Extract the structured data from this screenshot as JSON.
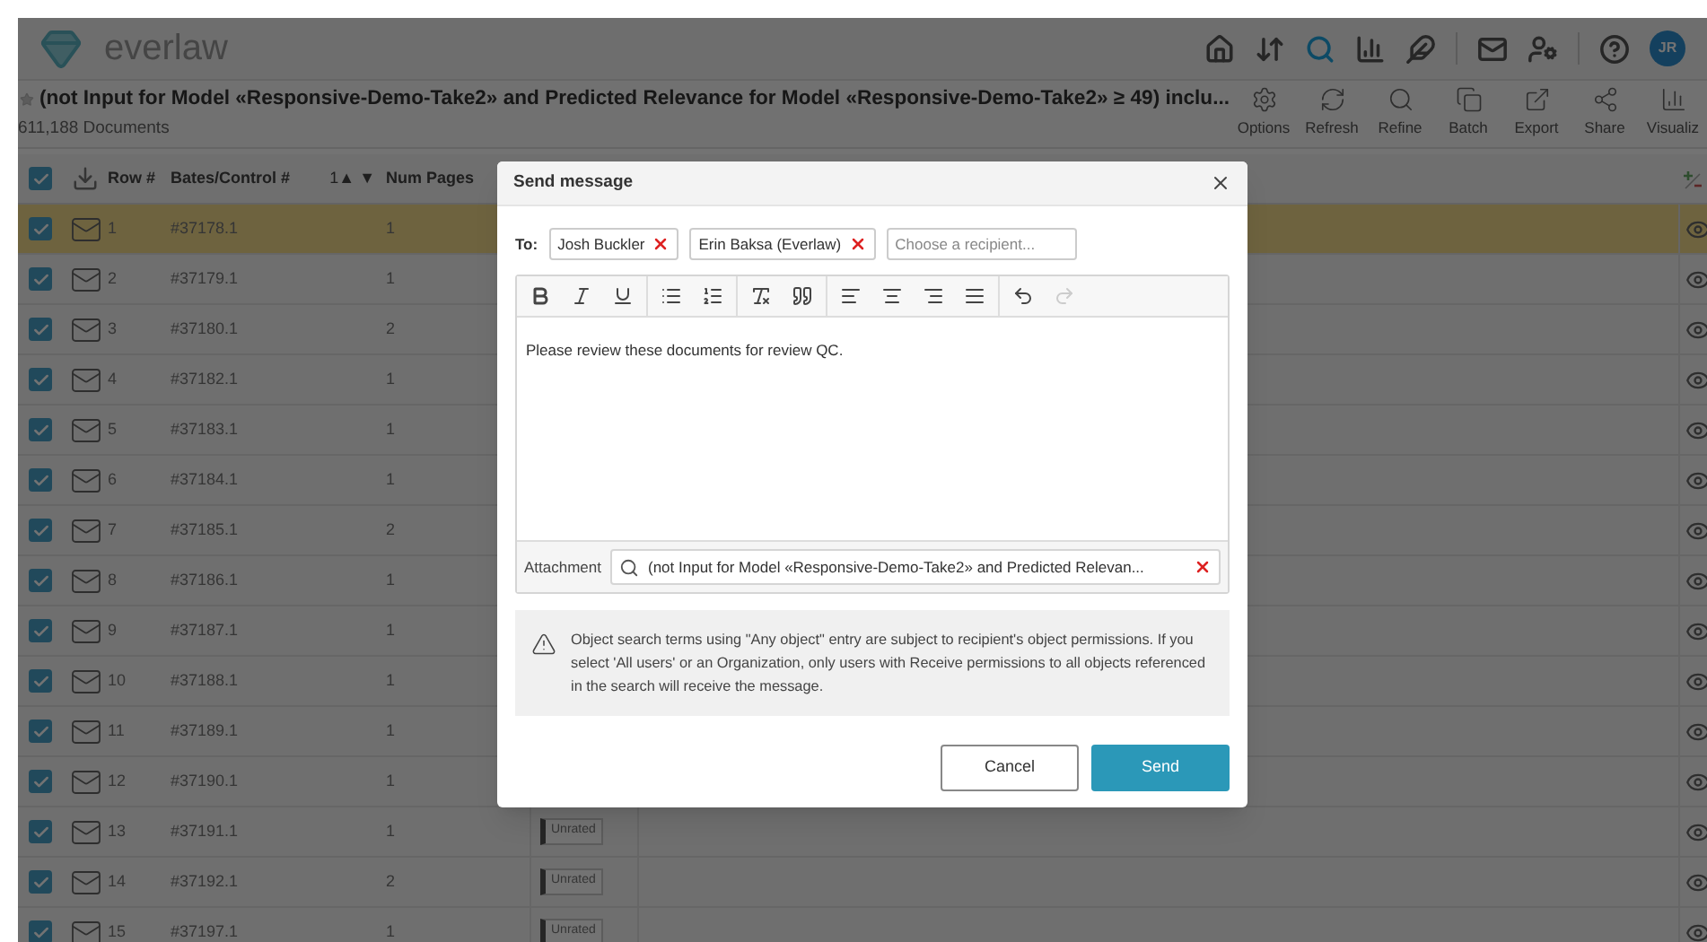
{
  "header": {
    "logo": "everlaw",
    "avatar": "JR",
    "nav": [
      {
        "kind": "home",
        "selected": false
      },
      {
        "kind": "sort",
        "selected": false
      },
      {
        "kind": "search",
        "selected": true
      },
      {
        "kind": "chart",
        "selected": false
      },
      {
        "kind": "feather",
        "selected": false
      },
      {
        "kind": "mail",
        "selected": false
      },
      {
        "kind": "admin",
        "selected": false
      },
      {
        "kind": "help",
        "selected": false
      }
    ]
  },
  "search": {
    "title": "(not Input for Model «Responsive-Demo-Take2» and Predicted Relevance for Model «Responsive-Demo-Take2» ≥ 49) inclu...",
    "count": "611,188 Documents",
    "actions": [
      {
        "kind": "options",
        "label": "Options"
      },
      {
        "kind": "refresh",
        "label": "Refresh"
      },
      {
        "kind": "refine",
        "label": "Refine"
      },
      {
        "kind": "batch",
        "label": "Batch"
      },
      {
        "kind": "export",
        "label": "Export"
      },
      {
        "kind": "share",
        "label": "Share"
      },
      {
        "kind": "visualize",
        "label": "Visualiz"
      }
    ]
  },
  "table": {
    "all_checked": true,
    "columns": [
      {
        "label": "Row #"
      },
      {
        "label": "Bates/Control #",
        "sort": "1▲ ▼"
      },
      {
        "label": "Num Pages"
      }
    ],
    "rows": [
      {
        "checked": true,
        "selected": true,
        "row": "1",
        "bates": "#37178.1",
        "pages": "1"
      },
      {
        "checked": true,
        "selected": false,
        "row": "2",
        "bates": "#37179.1",
        "pages": "1"
      },
      {
        "checked": true,
        "selected": false,
        "row": "3",
        "bates": "#37180.1",
        "pages": "2"
      },
      {
        "checked": true,
        "selected": false,
        "row": "4",
        "bates": "#37182.1",
        "pages": "1"
      },
      {
        "checked": true,
        "selected": false,
        "row": "5",
        "bates": "#37183.1",
        "pages": "1"
      },
      {
        "checked": true,
        "selected": false,
        "row": "6",
        "bates": "#37184.1",
        "pages": "1"
      },
      {
        "checked": true,
        "selected": false,
        "row": "7",
        "bates": "#37185.1",
        "pages": "2"
      },
      {
        "checked": true,
        "selected": false,
        "row": "8",
        "bates": "#37186.1",
        "pages": "1"
      },
      {
        "checked": true,
        "selected": false,
        "row": "9",
        "bates": "#37187.1",
        "pages": "1"
      },
      {
        "checked": true,
        "selected": false,
        "row": "10",
        "bates": "#37188.1",
        "pages": "1"
      },
      {
        "checked": true,
        "selected": false,
        "row": "11",
        "bates": "#37189.1",
        "pages": "1"
      },
      {
        "checked": true,
        "selected": false,
        "row": "12",
        "bates": "#37190.1",
        "pages": "1"
      },
      {
        "checked": true,
        "selected": false,
        "row": "13",
        "bates": "#37191.1",
        "pages": "1",
        "rating": "Unrated"
      },
      {
        "checked": true,
        "selected": false,
        "row": "14",
        "bates": "#37192.1",
        "pages": "2",
        "rating": "Unrated"
      },
      {
        "checked": true,
        "selected": false,
        "row": "15",
        "bates": "#37197.1",
        "pages": "1",
        "rating": "Unrated"
      }
    ]
  },
  "dialog": {
    "title": "Send message",
    "to_label": "To:",
    "recipients": [
      {
        "name": "Josh Buckler"
      },
      {
        "name": "Erin Baksa (Everlaw)"
      }
    ],
    "recipient_placeholder": "Choose a recipient...",
    "editor_toolbar": [
      [
        {
          "kind": "bold",
          "disabled": false
        },
        {
          "kind": "italic",
          "disabled": false
        },
        {
          "kind": "underline",
          "disabled": false
        }
      ],
      [
        {
          "kind": "bullets",
          "disabled": false
        },
        {
          "kind": "numbers",
          "disabled": false
        }
      ],
      [
        {
          "kind": "clear",
          "disabled": false
        },
        {
          "kind": "quote",
          "disabled": false
        }
      ],
      [
        {
          "kind": "align-left",
          "disabled": false
        },
        {
          "kind": "align-center",
          "disabled": false
        },
        {
          "kind": "align-right",
          "disabled": false
        },
        {
          "kind": "justify",
          "disabled": false
        }
      ],
      [
        {
          "kind": "undo",
          "disabled": false
        },
        {
          "kind": "redo",
          "disabled": true
        }
      ]
    ],
    "body": "Please review these documents for review QC.",
    "attachment_label": "Attachment",
    "attachment": "(not Input for Model «Responsive-Demo-Take2» and Predicted Relevan...",
    "notice": "Object search terms using \"Any object\" entry are subject to recipient's object permissions. If you select 'All users' or an Organization, only users with Receive permissions to all objects referenced in the search will receive the message.",
    "cancel": "Cancel",
    "send": "Send"
  }
}
